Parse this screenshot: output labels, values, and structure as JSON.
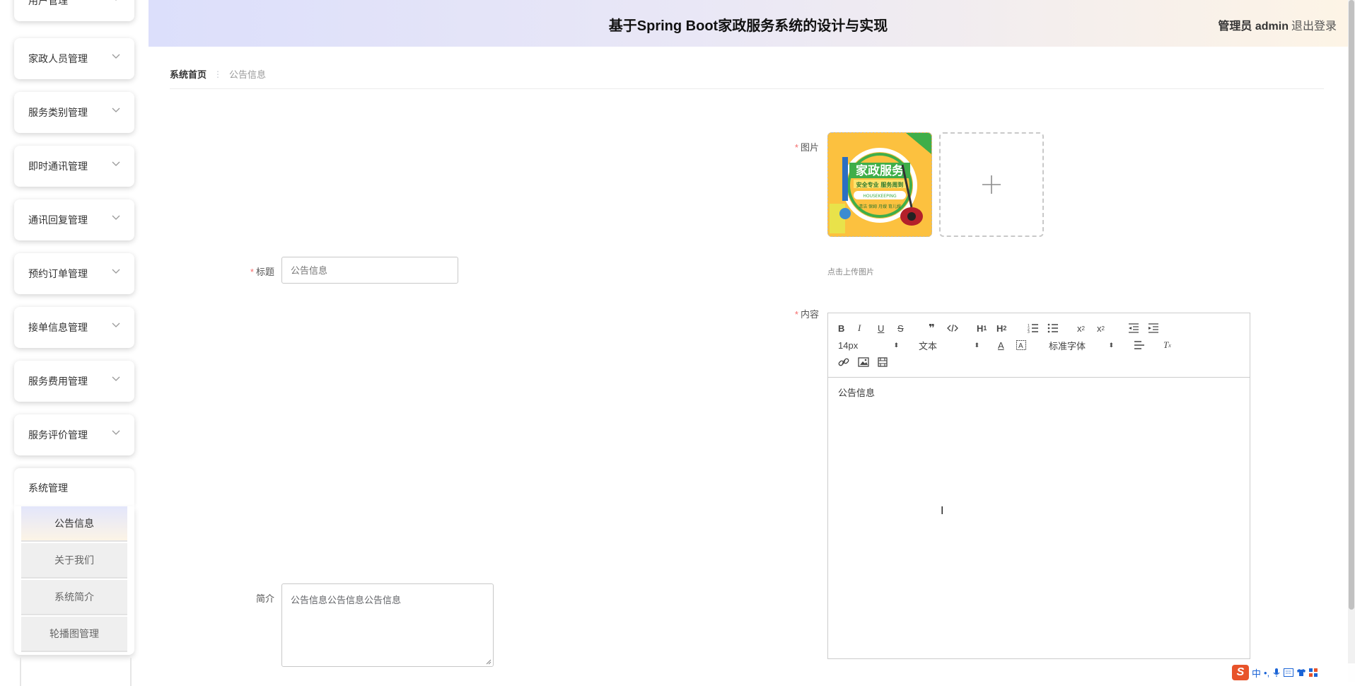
{
  "header": {
    "title": "基于Spring Boot家政服务系统的设计与实现",
    "user": "管理员 admin",
    "logout": "退出登录"
  },
  "sidebar": {
    "items": [
      {
        "label": "用户管理"
      },
      {
        "label": "家政人员管理"
      },
      {
        "label": "服务类别管理"
      },
      {
        "label": "即时通讯管理"
      },
      {
        "label": "通讯回复管理"
      },
      {
        "label": "预约订单管理"
      },
      {
        "label": "接单信息管理"
      },
      {
        "label": "服务费用管理"
      },
      {
        "label": "服务评价管理"
      }
    ],
    "system": {
      "label": "系统管理",
      "sub_items": [
        {
          "label": "公告信息",
          "active": true
        },
        {
          "label": "关于我们"
        },
        {
          "label": "系统简介"
        },
        {
          "label": "轮播图管理"
        }
      ]
    }
  },
  "breadcrumb": {
    "home": "系统首页",
    "separator": "⋮",
    "current": "公告信息"
  },
  "form": {
    "title_label": "标题",
    "title_placeholder": "公告信息",
    "image_label": "图片",
    "upload_tip": "点击上传图片",
    "image_text": {
      "main": "家政服务",
      "sub": "安全专业 服务周到",
      "en": "HOUSEKEEPING",
      "tags": "清洁 保姆 月嫂 育儿嫂"
    },
    "content_label": "内容",
    "content_value": "公告信息",
    "summary_label": "简介",
    "summary_value": "公告信息公告信息公告信息"
  },
  "editor": {
    "font_size": "14px",
    "heading": "文本",
    "font_family": "标准字体"
  },
  "ime": {
    "logo": "S",
    "lang": "中"
  },
  "colors": {
    "required": "#f56c6c",
    "header_left": "#dcdffb",
    "header_right": "#fdf4e6",
    "thumb_bg": "#fcc13f"
  }
}
